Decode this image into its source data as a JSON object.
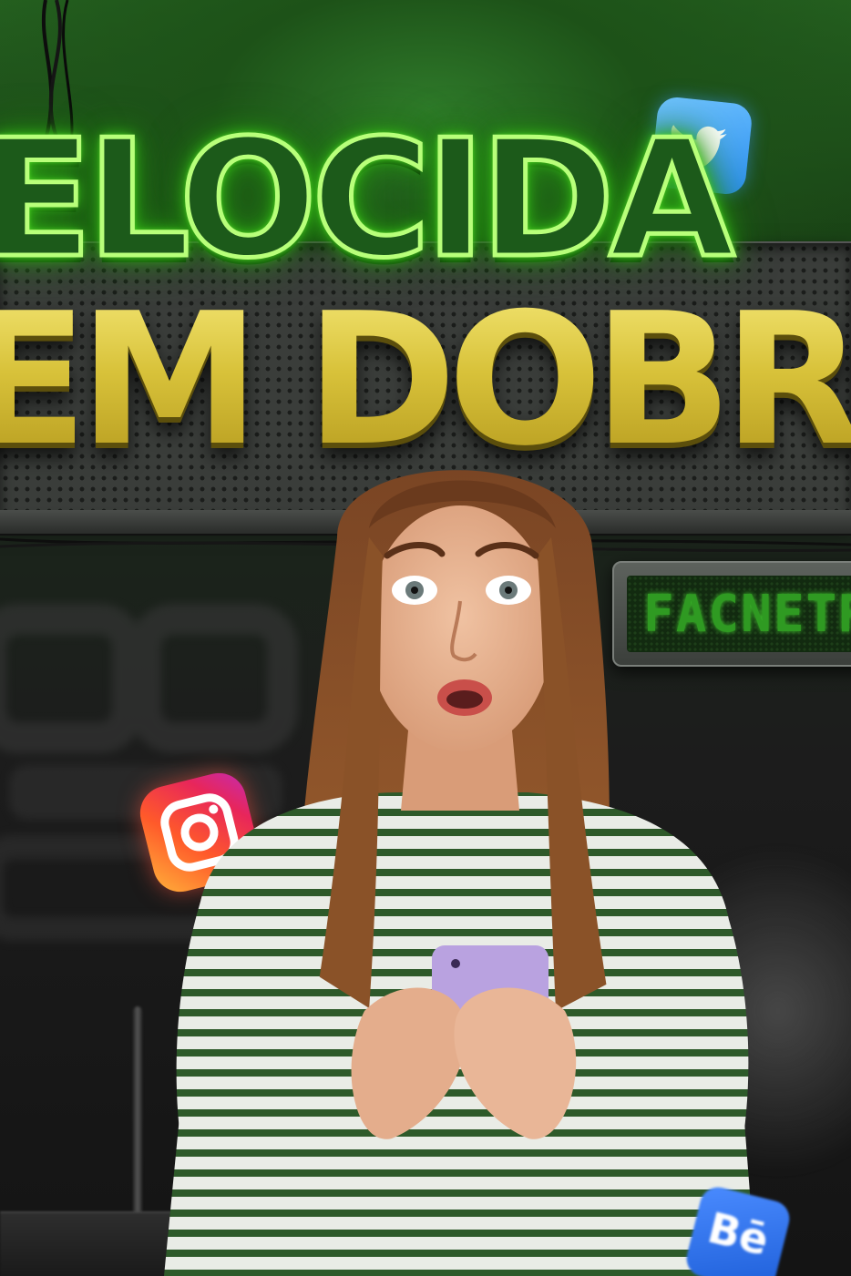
{
  "headline": {
    "neon_text": "ELOCIDA",
    "neon_partial_glyph": "E",
    "yellow_text": "EM DOBRO",
    "neon_color": "#7dff3c",
    "yellow_color": "#d9c43a"
  },
  "led_sign": {
    "text": "FACNETR"
  },
  "social_icons": {
    "twitter": "twitter-icon",
    "instagram": "instagram-icon",
    "behance": "behance-icon",
    "behance_label": "Bē"
  },
  "background_logo": {
    "icon": "blurred-brand-logo"
  },
  "person": {
    "icon": "surprised-woman-holding-phone",
    "phone_color": "#b9a2e0",
    "shirt_stripe_color": "#2e5a2a"
  }
}
